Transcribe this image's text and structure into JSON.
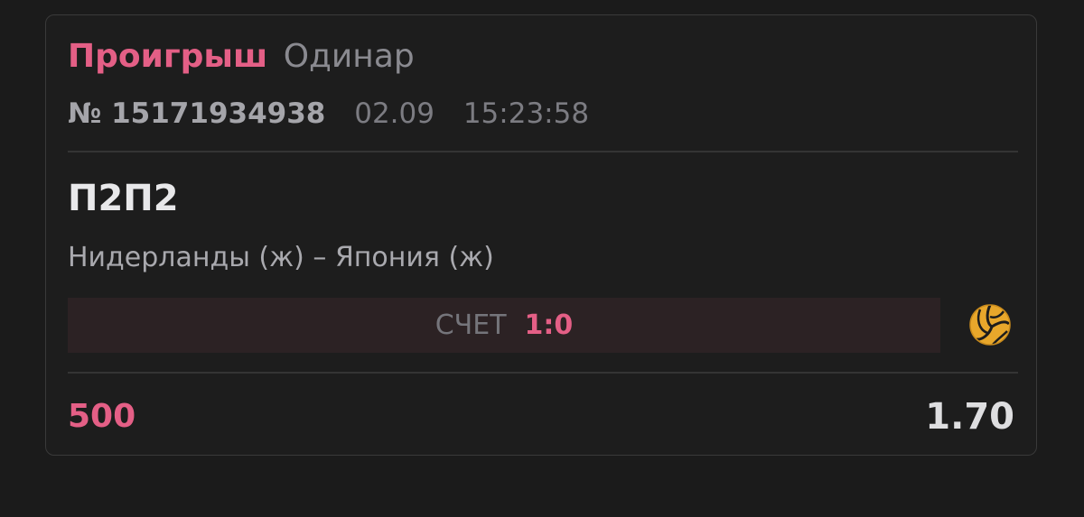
{
  "bet": {
    "status": "Проигрыш",
    "type": "Одинар",
    "ticket": "№ 15171934938",
    "date": "02.09",
    "time": "15:23:58"
  },
  "selection": {
    "market": "П2П2",
    "event": "Нидерланды (ж) – Япония (ж)",
    "score_label": "СЧЕТ",
    "score_value": "1:0",
    "sport_icon": "volleyball-icon"
  },
  "summary": {
    "stake": "500",
    "odds": "1.70"
  },
  "colors": {
    "loss_accent": "#e45f86",
    "background": "#1b1b1b",
    "volleyball": "#e8a72b"
  }
}
